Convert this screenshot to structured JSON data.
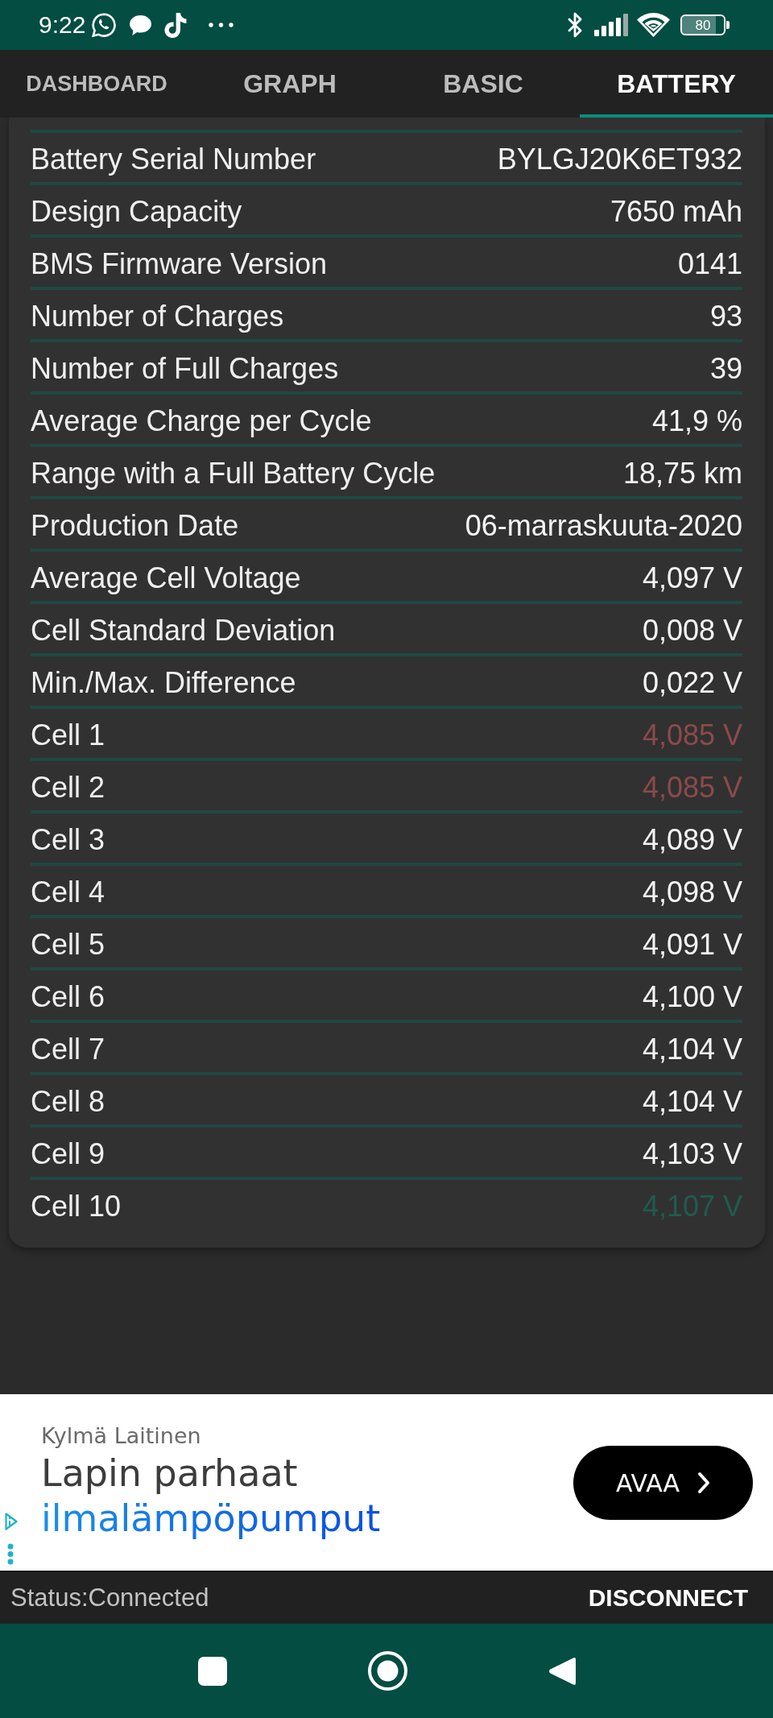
{
  "status_bar": {
    "time": "9:22",
    "battery": "80"
  },
  "tabs": [
    {
      "label": "DASHBOARD",
      "selected": false
    },
    {
      "label": "GRAPH",
      "selected": false
    },
    {
      "label": "BASIC",
      "selected": false
    },
    {
      "label": "BATTERY",
      "selected": true
    }
  ],
  "battery_info": {
    "rows": [
      {
        "label": "Battery Serial Number",
        "value": "BYLGJ20K6ET932"
      },
      {
        "label": "Design Capacity",
        "value": "7650 mAh"
      },
      {
        "label": "BMS Firmware Version",
        "value": "0141"
      },
      {
        "label": "Number of Charges",
        "value": "93"
      },
      {
        "label": "Number of Full Charges",
        "value": "39"
      },
      {
        "label": "Average Charge per Cycle",
        "value": "41,9 %"
      },
      {
        "label": "Range with a Full Battery Cycle",
        "value": "18,75 km"
      },
      {
        "label": "Production Date",
        "value": "06-marraskuuta-2020"
      },
      {
        "label": "Average Cell Voltage",
        "value": "4,097 V"
      },
      {
        "label": "Cell Standard Deviation",
        "value": "0,008 V"
      },
      {
        "label": "Min./Max. Difference",
        "value": "0,022 V"
      },
      {
        "label": "Cell 1",
        "value": "4,085 V",
        "color": "#8c4a4a"
      },
      {
        "label": "Cell 2",
        "value": "4,085 V",
        "color": "#8c4a4a"
      },
      {
        "label": "Cell 3",
        "value": "4,089 V"
      },
      {
        "label": "Cell 4",
        "value": "4,098 V"
      },
      {
        "label": "Cell 5",
        "value": "4,091 V"
      },
      {
        "label": "Cell 6",
        "value": "4,100 V"
      },
      {
        "label": "Cell 7",
        "value": "4,104 V"
      },
      {
        "label": "Cell 8",
        "value": "4,104 V"
      },
      {
        "label": "Cell 9",
        "value": "4,103 V"
      },
      {
        "label": "Cell 10",
        "value": "4,107 V",
        "color": "#1f5c4e"
      }
    ]
  },
  "ad": {
    "advertiser": "Kylmä Laitinen",
    "headline": "Lapin parhaat",
    "headline_highlight": "ilmalämpöpumput",
    "button": "AVAA"
  },
  "connection_bar": {
    "status": "Status:Connected",
    "button": "DISCONNECT"
  }
}
